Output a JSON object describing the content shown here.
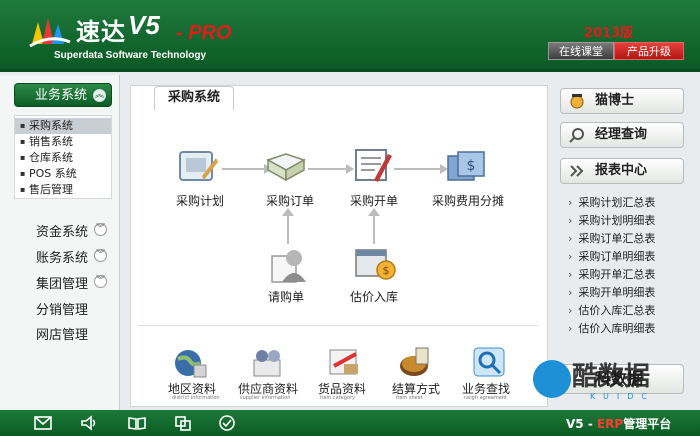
{
  "header": {
    "logo_cn": "速达",
    "logo_v5": "V5",
    "logo_pro": "- PRO",
    "logo_sub": "Superdata Software Technology",
    "year": "2013版",
    "online_btn": "在线课堂",
    "upgrade_btn": "产品升级"
  },
  "leftnav": {
    "top": "业务系统",
    "subitems": [
      "采购系统",
      "销售系统",
      "仓库系统",
      "POS 系统",
      "售后管理"
    ],
    "items": [
      "资金系统",
      "账务系统",
      "集团管理",
      "分销管理",
      "网店管理"
    ]
  },
  "main": {
    "tab": "采购系统",
    "flow": {
      "plan": "采购计划",
      "order": "采购订单",
      "invoice": "采购开单",
      "cost": "采购费用分摊",
      "request": "请购单",
      "estimate": "估价入库"
    },
    "bottom": [
      {
        "label": "地区资料",
        "sub": "district information"
      },
      {
        "label": "供应商资料",
        "sub": "supplier information"
      },
      {
        "label": "货品资料",
        "sub": "item category"
      },
      {
        "label": "结算方式",
        "sub": "item sheet"
      },
      {
        "label": "业务查找",
        "sub": "neigh agreement"
      }
    ]
  },
  "right": {
    "cat": "猫博士",
    "query": "经理查询",
    "reports": "报表中心",
    "links": [
      "采购计划汇总表",
      "采购计划明细表",
      "采购订单汇总表",
      "采购订单明细表",
      "采购开单汇总表",
      "采购开单明细表",
      "估价入库汇总表",
      "估价入库明细表"
    ],
    "hidden_btn": "科数据"
  },
  "watermark": {
    "text": "酷数据",
    "sub": "KUIDC"
  },
  "footer": {
    "v5": "V5 -",
    "erp": "ERP",
    "platform": "管理平台"
  }
}
